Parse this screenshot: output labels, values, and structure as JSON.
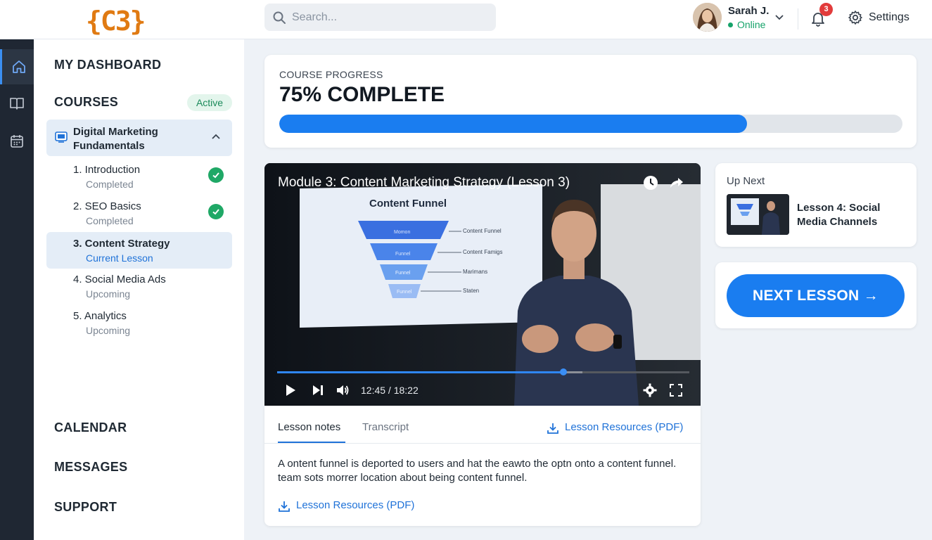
{
  "header": {
    "logo_text": "{C3}",
    "search_placeholder": "Search...",
    "user": {
      "name": "Sarah J.",
      "status": "Online"
    },
    "notifications_count": "3",
    "settings_label": "Settings"
  },
  "rail": {
    "items": [
      "home-icon",
      "book-icon",
      "calendar-icon"
    ]
  },
  "sidebar": {
    "dashboard_label": "MY DASHBOARD",
    "courses_label": "COURSES",
    "courses_badge": "Active",
    "course": {
      "title": "Digital Marketing Fundamentals"
    },
    "lessons": [
      {
        "title": "1. Introduction",
        "status": "Completed"
      },
      {
        "title": "2. SEO Basics",
        "status": "Completed"
      },
      {
        "title": "3. Content Strategy",
        "status": "Current Lesson"
      },
      {
        "title": "4. Social Media Ads",
        "status": "Upcoming"
      },
      {
        "title": "5. Analytics",
        "status": "Upcoming"
      }
    ],
    "calendar_label": "CALENDAR",
    "messages_label": "MESSAGES",
    "support_label": "SUPPORT"
  },
  "progress": {
    "label": "COURSE PROGRESS",
    "value_text": "75% COMPLETE",
    "fraction": 0.75
  },
  "video": {
    "title": "Module 3: Content Marketing Strategy (Lesson 3)",
    "slide_title": "Content Funnel",
    "funnel_labels": [
      "Content Funnel",
      "Content Famigs",
      "Marimans",
      "Staten"
    ],
    "funnel_inner": [
      "Momon",
      "Funnel",
      "Funnel",
      "Funnel"
    ],
    "time": "12:45 / 18:22",
    "played_fraction": 0.694,
    "buffered_fraction": 0.74
  },
  "notes": {
    "tab_notes": "Lesson notes",
    "tab_transcript": "Transcript",
    "resources_link": "Lesson Resources (PDF)",
    "body": "A ontent funnel is deported to users and hat the eawto the optn onto a content funnel. team sots morrer location about being content funnel.",
    "body_link": "Lesson Resources (PDF)"
  },
  "up_next": {
    "label": "Up Next",
    "title": "Lesson 4: Social Media Channels"
  },
  "next_button": {
    "label": "NEXT LESSON →"
  },
  "colors": {
    "accent": "#1a7df0",
    "success": "#1fa866",
    "logo": "#e07a12",
    "rail": "#1f2733"
  }
}
